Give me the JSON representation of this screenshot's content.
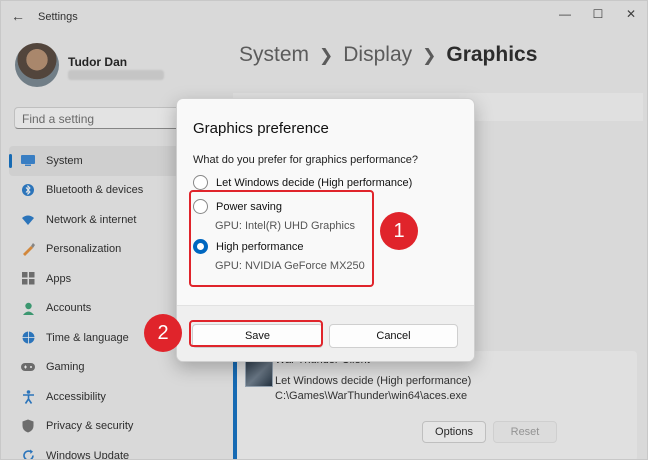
{
  "window": {
    "title": "Settings"
  },
  "profile": {
    "name": "Tudor Dan"
  },
  "search": {
    "placeholder": "Find a setting"
  },
  "sidebar": {
    "items": [
      {
        "label": "System",
        "icon": "system-icon",
        "active": true
      },
      {
        "label": "Bluetooth & devices",
        "icon": "bluetooth-icon"
      },
      {
        "label": "Network & internet",
        "icon": "wifi-icon"
      },
      {
        "label": "Personalization",
        "icon": "brush-icon"
      },
      {
        "label": "Apps",
        "icon": "apps-icon"
      },
      {
        "label": "Accounts",
        "icon": "person-icon"
      },
      {
        "label": "Time & language",
        "icon": "globe-icon"
      },
      {
        "label": "Gaming",
        "icon": "gamepad-icon"
      },
      {
        "label": "Accessibility",
        "icon": "accessibility-icon"
      },
      {
        "label": "Privacy & security",
        "icon": "shield-icon"
      },
      {
        "label": "Windows Update",
        "icon": "update-icon"
      }
    ]
  },
  "breadcrumb": {
    "part1": "System",
    "part2": "Display",
    "current": "Graphics"
  },
  "app_card": {
    "name": "War Thunder Client",
    "preference": "Let Windows decide (High performance)",
    "path": "C:\\Games\\WarThunder\\win64\\aces.exe",
    "options_label": "Options",
    "reset_label": "Reset"
  },
  "dialog": {
    "title": "Graphics preference",
    "question": "What do you prefer for graphics performance?",
    "options": [
      {
        "label": "Let Windows decide (High performance)",
        "sub": "",
        "selected": false
      },
      {
        "label": "Power saving",
        "sub": "GPU: Intel(R) UHD Graphics",
        "selected": false
      },
      {
        "label": "High performance",
        "sub": "GPU: NVIDIA GeForce MX250",
        "selected": true
      }
    ],
    "save_label": "Save",
    "cancel_label": "Cancel"
  },
  "annotations": {
    "callout1": "1",
    "callout2": "2"
  },
  "colors": {
    "accent": "#0067c0",
    "annotation_red": "#e0242b"
  }
}
